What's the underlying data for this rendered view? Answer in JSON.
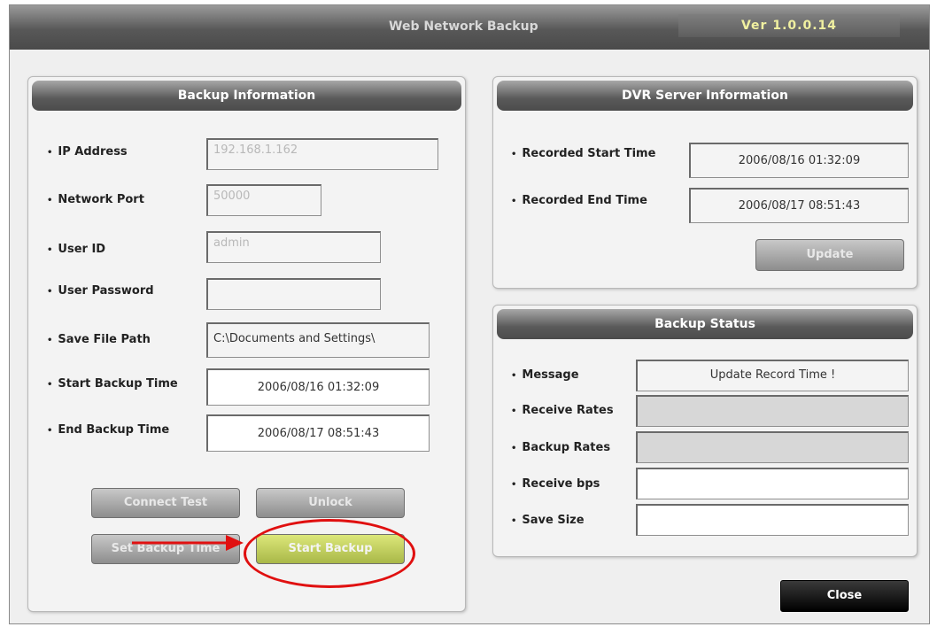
{
  "window": {
    "title": "Web Network Backup",
    "version": "Ver 1.0.0.14"
  },
  "backup_info": {
    "header": "Backup Information",
    "labels": {
      "ip": "IP Address",
      "port": "Network Port",
      "user_id": "User ID",
      "password": "User Password",
      "save_path": "Save File Path",
      "start_time": "Start Backup Time",
      "end_time": "End Backup Time"
    },
    "values": {
      "ip": "192.168.1.162",
      "port": "50000",
      "user_id": "admin",
      "password": "",
      "save_path": "C:\\Documents and Settings\\",
      "start_time": "2006/08/16 01:32:09",
      "end_time": "2006/08/17 08:51:43"
    },
    "buttons": {
      "connect_test": "Connect Test",
      "unlock": "Unlock",
      "set_backup_time": "Set Backup Time",
      "start_backup": "Start Backup"
    }
  },
  "dvr_info": {
    "header": "DVR Server Information",
    "labels": {
      "rec_start": "Recorded Start Time",
      "rec_end": "Recorded End Time"
    },
    "values": {
      "rec_start": "2006/08/16 01:32:09",
      "rec_end": "2006/08/17 08:51:43"
    },
    "update_button": "Update"
  },
  "backup_status": {
    "header": "Backup Status",
    "labels": {
      "message": "Message",
      "receive_rates": "Receive Rates",
      "backup_rates": "Backup Rates",
      "receive_bps": "Receive bps",
      "save_size": "Save Size"
    },
    "values": {
      "message": "Update Record Time !",
      "receive_rates": "",
      "backup_rates": "",
      "receive_bps": "",
      "save_size": ""
    }
  },
  "close_button": "Close",
  "colors": {
    "annotation": "#e01010",
    "start_backup": "#c4d263"
  }
}
